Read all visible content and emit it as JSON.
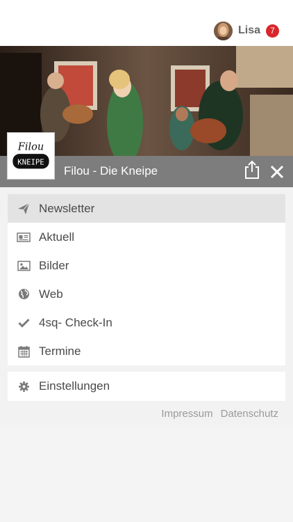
{
  "header": {
    "user_name": "Lisa",
    "notification_count": "7",
    "badge_color": "#d9262b"
  },
  "app": {
    "title": "Filou - Die Kneipe",
    "logo_text": "Filou Kneipe"
  },
  "menu": {
    "items": [
      {
        "label": "Newsletter",
        "icon": "paper-plane-icon",
        "active": true
      },
      {
        "label": "Aktuell",
        "icon": "newspaper-icon",
        "active": false
      },
      {
        "label": "Bilder",
        "icon": "image-icon",
        "active": false
      },
      {
        "label": "Web",
        "icon": "globe-icon",
        "active": false
      },
      {
        "label": "4sq- Check-In",
        "icon": "checkmark-icon",
        "active": false
      },
      {
        "label": "Termine",
        "icon": "calendar-icon",
        "active": false
      }
    ],
    "settings_label": "Einstellungen"
  },
  "footer": {
    "impressum": "Impressum",
    "datenschutz": "Datenschutz"
  }
}
